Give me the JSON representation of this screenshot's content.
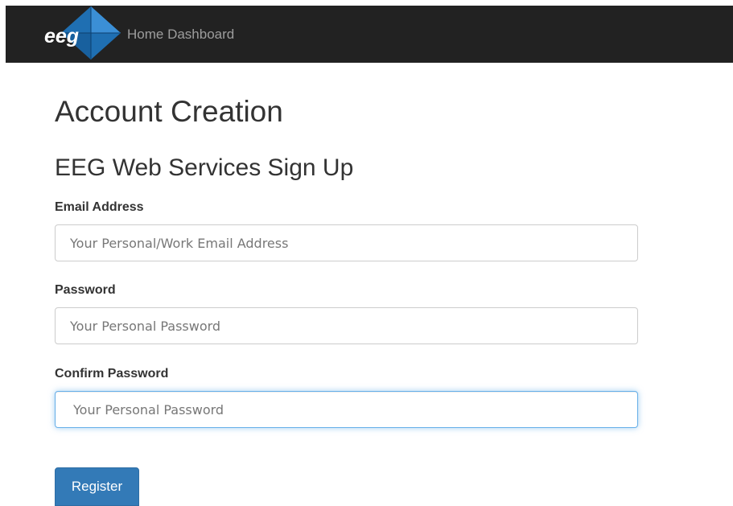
{
  "navbar": {
    "brand_text": "eeg",
    "link_label": "Home Dashboard",
    "background": "#222222"
  },
  "page": {
    "title": "Account Creation",
    "subtitle": "EEG Web Services Sign Up"
  },
  "form": {
    "email": {
      "label": "Email Address",
      "placeholder": "Your Personal/Work Email Address",
      "value": ""
    },
    "password": {
      "label": "Password",
      "placeholder": "Your Personal Password",
      "value": ""
    },
    "confirm_password": {
      "label": "Confirm Password",
      "placeholder": "Your Personal Password",
      "value": "",
      "focused": true
    },
    "submit_label": "Register"
  },
  "colors": {
    "primary_button": "#337ab7",
    "focus_border": "#66afe9",
    "logo_blue": "#1f6fb2"
  }
}
